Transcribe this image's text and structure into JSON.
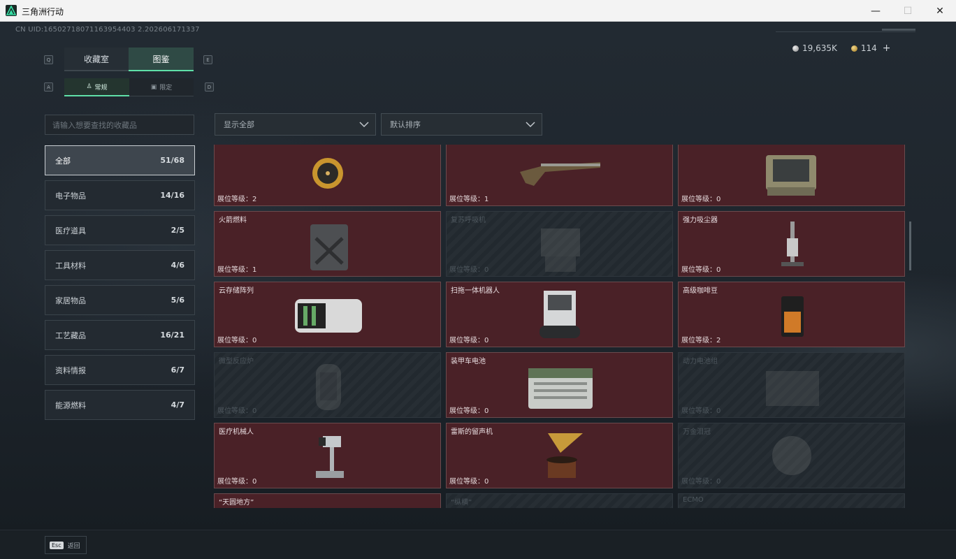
{
  "window": {
    "title": "三角洲行动",
    "min": "—",
    "max": "☐",
    "close": "✕"
  },
  "header": {
    "uid": "CN UID:16502718071163954403 2.202606171337",
    "silver": "19,635K",
    "gold": "114",
    "plus": "+"
  },
  "keys": {
    "q": "Q",
    "e": "E",
    "a": "A",
    "d": "D"
  },
  "tabs": {
    "collection_room": "收藏室",
    "catalog": "图鉴"
  },
  "subtabs": {
    "normal": "常规",
    "limited": "限定"
  },
  "search": {
    "placeholder": "请输入想要查找的收藏品"
  },
  "categories": [
    {
      "label": "全部",
      "count": "51/68"
    },
    {
      "label": "电子物品",
      "count": "14/16"
    },
    {
      "label": "医疗道具",
      "count": "2/5"
    },
    {
      "label": "工具材料",
      "count": "4/6"
    },
    {
      "label": "家居物品",
      "count": "5/6"
    },
    {
      "label": "工艺藏品",
      "count": "16/21"
    },
    {
      "label": "资料情报",
      "count": "6/7"
    },
    {
      "label": "能源燃料",
      "count": "4/7"
    }
  ],
  "filters": {
    "show": "显示全部",
    "sort": "默认排序"
  },
  "items": [
    {
      "name": "",
      "level": "展位等级：2",
      "locked": false,
      "icon": "gold-watch"
    },
    {
      "name": "",
      "level": "展位等级：1",
      "locked": false,
      "icon": "flintlock-rifle"
    },
    {
      "name": "",
      "level": "展位等级：0",
      "locked": false,
      "icon": "rugged-laptop"
    },
    {
      "name": "火箭燃料",
      "level": "展位等级：1",
      "locked": false,
      "icon": "fuel-can"
    },
    {
      "name": "复苏呼吸机",
      "level": "展位等级：0",
      "locked": true,
      "icon": "ventilator"
    },
    {
      "name": "强力吸尘器",
      "level": "展位等级：0",
      "locked": false,
      "icon": "vacuum-cleaner"
    },
    {
      "name": "云存储阵列",
      "level": "展位等级：0",
      "locked": false,
      "icon": "storage-array"
    },
    {
      "name": "扫拖一体机器人",
      "level": "展位等级：0",
      "locked": false,
      "icon": "robot-mop"
    },
    {
      "name": "高级咖啡豆",
      "level": "展位等级：2",
      "locked": false,
      "icon": "coffee-bag"
    },
    {
      "name": "微型反应炉",
      "level": "展位等级：0",
      "locked": true,
      "icon": "micro-reactor"
    },
    {
      "name": "装甲车电池",
      "level": "展位等级：0",
      "locked": false,
      "icon": "vehicle-battery"
    },
    {
      "name": "动力电池组",
      "level": "展位等级：0",
      "locked": true,
      "icon": "battery-pack"
    },
    {
      "name": "医疗机械人",
      "level": "展位等级：0",
      "locked": false,
      "icon": "medical-robot"
    },
    {
      "name": "雷斯的留声机",
      "level": "展位等级：0",
      "locked": false,
      "icon": "gramophone"
    },
    {
      "name": "万金泪冠",
      "level": "展位等级：0",
      "locked": true,
      "icon": "crown"
    },
    {
      "name": "“天圆地方”",
      "level": "",
      "locked": false,
      "icon": "gold-watch"
    },
    {
      "name": "“纵横”",
      "level": "",
      "locked": true,
      "icon": "item"
    },
    {
      "name": "ECMO",
      "level": "",
      "locked": true,
      "icon": "item"
    }
  ],
  "footer": {
    "esc_key": "Esc",
    "back": "返回"
  }
}
